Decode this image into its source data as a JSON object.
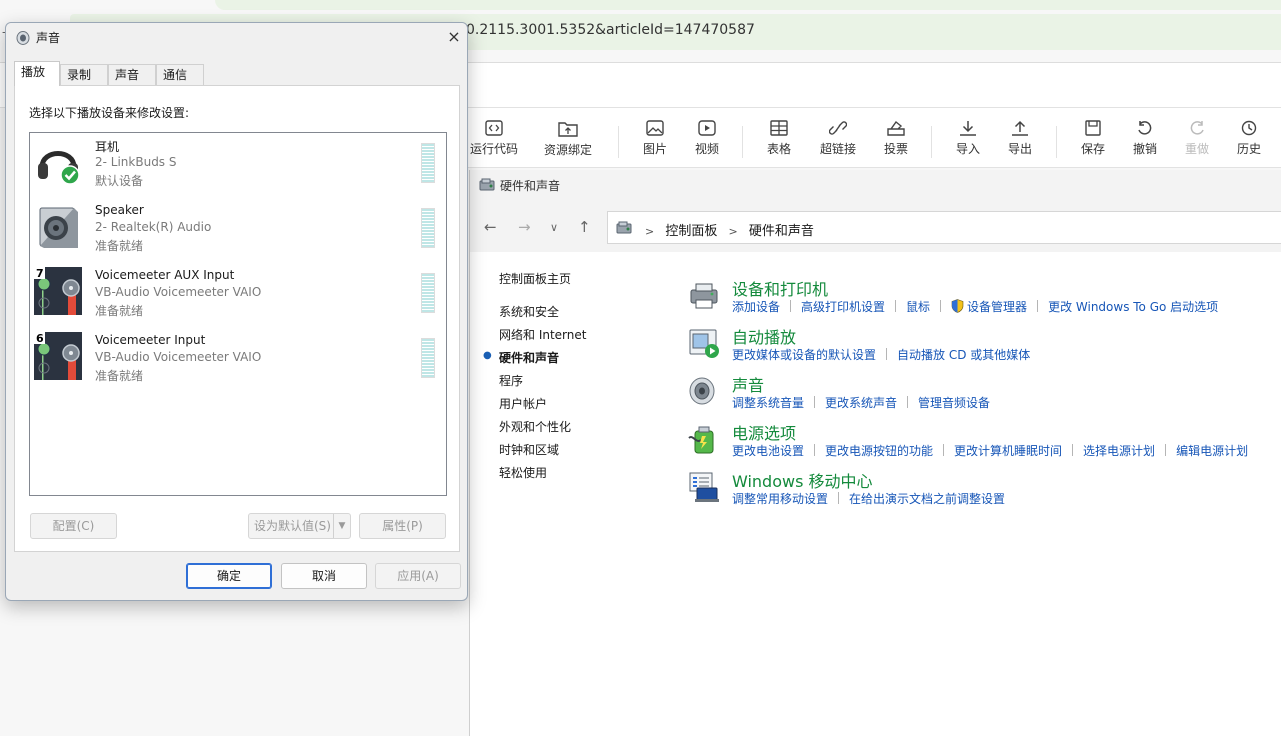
{
  "browser": {
    "address": "0.2115.3001.5352&articleId=147470587",
    "left_glyph": "-",
    "toolbar": [
      {
        "label": "运行代码",
        "icon": "code-icon"
      },
      {
        "label": "资源绑定",
        "icon": "upload-folder-icon"
      },
      {
        "label": "图片",
        "icon": "image-icon"
      },
      {
        "label": "视频",
        "icon": "video-icon"
      },
      {
        "label": "表格",
        "icon": "table-icon"
      },
      {
        "label": "超链接",
        "icon": "link-icon"
      },
      {
        "label": "投票",
        "icon": "vote-icon"
      },
      {
        "label": "导入",
        "icon": "download-icon"
      },
      {
        "label": "导出",
        "icon": "export-icon"
      },
      {
        "label": "保存",
        "icon": "save-icon"
      },
      {
        "label": "撤销",
        "icon": "undo-icon"
      },
      {
        "label": "重做",
        "icon": "redo-icon"
      },
      {
        "label": "历史",
        "icon": "history-icon"
      }
    ]
  },
  "control_panel": {
    "title": "硬件和声音",
    "breadcrumb": [
      "控制面板",
      "硬件和声音"
    ],
    "left_nav": [
      {
        "label": "控制面板主页",
        "current": false
      },
      {
        "label": "系统和安全",
        "current": false
      },
      {
        "label": "网络和 Internet",
        "current": false
      },
      {
        "label": "硬件和声音",
        "current": true
      },
      {
        "label": "程序",
        "current": false
      },
      {
        "label": "用户帐户",
        "current": false
      },
      {
        "label": "外观和个性化",
        "current": false
      },
      {
        "label": "时钟和区域",
        "current": false
      },
      {
        "label": "轻松使用",
        "current": false
      }
    ],
    "categories": [
      {
        "title": "设备和打印机",
        "icon": "printer-icon",
        "links": [
          "添加设备",
          "高级打印机设置",
          "鼠标",
          "设备管理器",
          "更改 Windows To Go 启动选项"
        ]
      },
      {
        "title": "自动播放",
        "icon": "autoplay-icon",
        "links": [
          "更改媒体或设备的默认设置",
          "自动播放 CD 或其他媒体"
        ]
      },
      {
        "title": "声音",
        "icon": "speaker-icon",
        "links": [
          "调整系统音量",
          "更改系统声音",
          "管理音频设备"
        ]
      },
      {
        "title": "电源选项",
        "icon": "power-icon",
        "links": [
          "更改电池设置",
          "更改电源按钮的功能",
          "更改计算机睡眠时间",
          "选择电源计划",
          "编辑电源计划"
        ]
      },
      {
        "title": "Windows 移动中心",
        "icon": "mobility-center-icon",
        "links": [
          "调整常用移动设置",
          "在给出演示文档之前调整设置"
        ]
      }
    ]
  },
  "sound_dialog": {
    "title": "声音",
    "close": "×",
    "tabs": [
      "播放",
      "录制",
      "声音",
      "通信"
    ],
    "active_tab": "播放",
    "instruction": "选择以下播放设备来修改设置:",
    "devices": [
      {
        "name": "耳机",
        "description": "2- LinkBuds S",
        "status": "默认设备",
        "icon": "headphones-icon",
        "default": true
      },
      {
        "name": "Speaker",
        "description": "2- Realtek(R) Audio",
        "status": "准备就绪",
        "icon": "speaker-device-icon",
        "default": false
      },
      {
        "name": "Voicemeeter AUX Input",
        "description": "VB-Audio Voicemeeter VAIO",
        "status": "准备就绪",
        "icon": "voicemeeter-aux-icon",
        "badge": "7",
        "default": false
      },
      {
        "name": "Voicemeeter Input",
        "description": "VB-Audio Voicemeeter VAIO",
        "status": "准备就绪",
        "icon": "voicemeeter-input-icon",
        "badge": "6",
        "default": false
      }
    ],
    "buttons": {
      "configure": "配置(C)",
      "set_default": "设为默认值(S)",
      "properties": "属性(P)",
      "ok": "确定",
      "cancel": "取消",
      "apply": "应用(A)"
    }
  },
  "colors": {
    "link": "#1756b7",
    "category_title": "#148a3c",
    "primary_border": "#2f6fd6"
  }
}
